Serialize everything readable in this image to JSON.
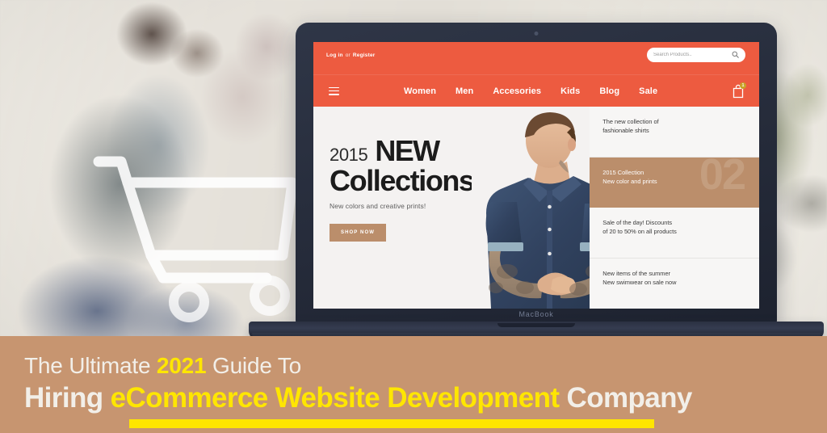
{
  "background": {
    "description": "blurred office photo with seated person",
    "cart_watermark_icon": "shopping-cart-icon"
  },
  "device": {
    "brand_label": "MacBook",
    "camera_icon": "webcam-icon"
  },
  "site": {
    "accent_color": "#ed5b40",
    "topbar": {
      "login_label": "Log in",
      "separator": "or",
      "register_label": "Register",
      "search": {
        "placeholder": "Search Products..",
        "value": "",
        "icon": "search-icon"
      }
    },
    "nav": {
      "menu_icon": "hamburger-menu-icon",
      "links": [
        {
          "label": "Women"
        },
        {
          "label": "Men"
        },
        {
          "label": "Accesories"
        },
        {
          "label": "Kids"
        },
        {
          "label": "Blog"
        },
        {
          "label": "Sale"
        }
      ],
      "cart": {
        "icon": "shopping-bag-icon",
        "badge_count": "1"
      }
    },
    "hero": {
      "year": "2015",
      "headline_word": "NEW",
      "headline_line2": "Collections",
      "subtitle": "New colors and creative prints!",
      "cta_label": "SHOP NOW",
      "model_image_alt": "male model in denim shirt"
    },
    "promos": [
      {
        "text": "The new collection of\nfashionable shirts",
        "highlight": false,
        "ghost_number": ""
      },
      {
        "text": "2015 Collection\nNew color and prints",
        "highlight": true,
        "ghost_number": "02"
      },
      {
        "text": "Sale of the day! Discounts\nof 20 to 50% on all products",
        "highlight": false,
        "ghost_number": ""
      },
      {
        "text": "New items of the summer\nNew swimwear on sale now",
        "highlight": false,
        "ghost_number": ""
      }
    ]
  },
  "banner": {
    "background_color": "#c79570",
    "highlight_color": "#ffe600",
    "line1": {
      "pre": "The Ultimate ",
      "highlight": "2021",
      "post": " Guide To"
    },
    "line2": {
      "pre": "Hiring ",
      "highlight": "eCommerce Website Development",
      "post": " Company"
    }
  }
}
